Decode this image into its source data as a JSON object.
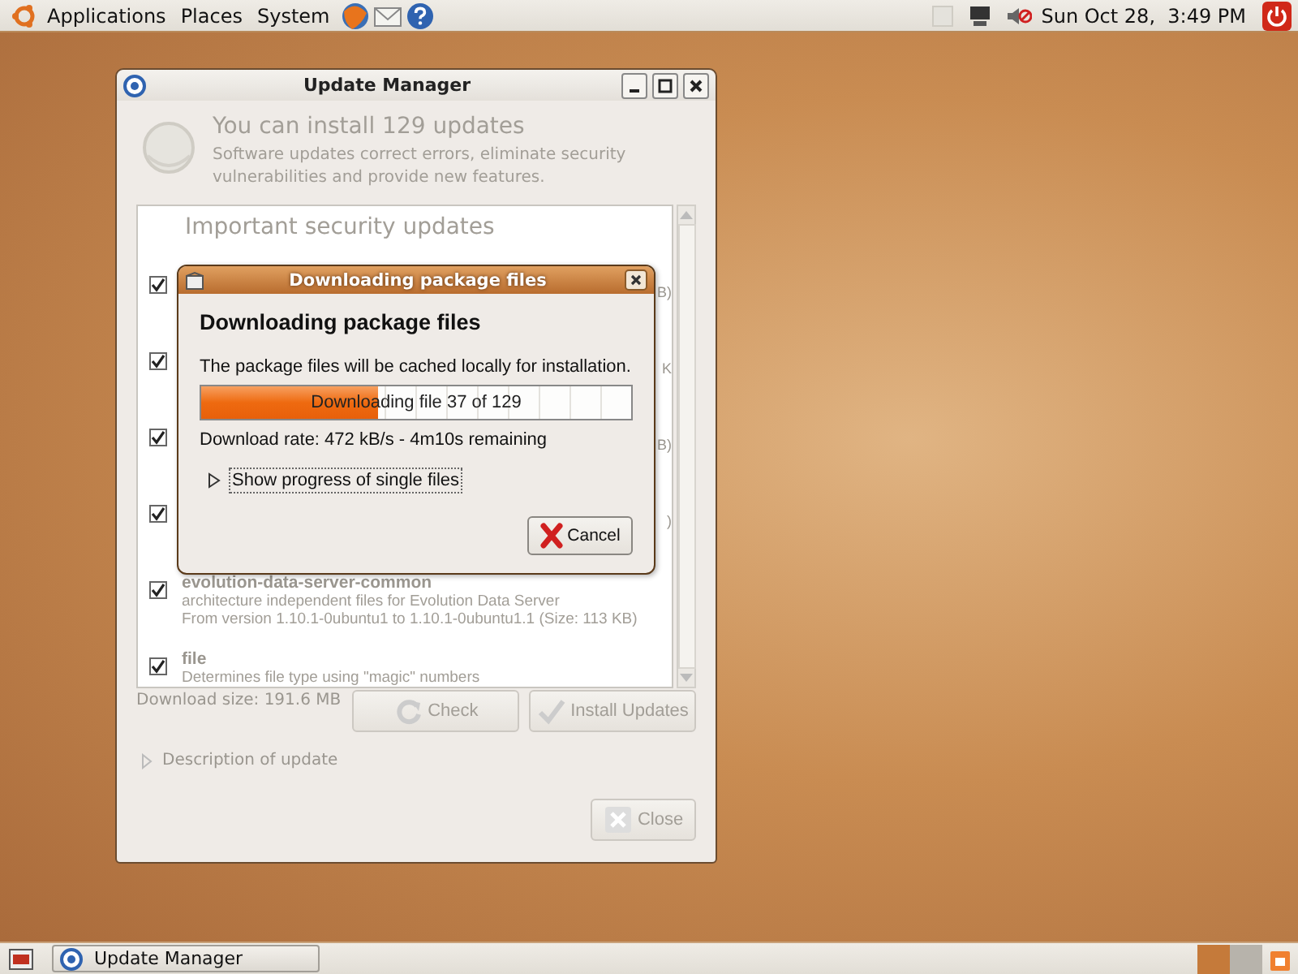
{
  "top_panel": {
    "menus": [
      "Applications",
      "Places",
      "System"
    ],
    "clock": "Sun Oct 28,  3:49 PM"
  },
  "update_window": {
    "title": "Update Manager",
    "insensitive": true,
    "heading": "You can install 129 updates",
    "description": "Software updates correct errors, eliminate security vulnerabilities and provide new features.",
    "list": {
      "section_title": "Important security updates",
      "rows": [
        {
          "checked": true,
          "size_fragment": "B)"
        },
        {
          "checked": true,
          "size_fragment": "K"
        },
        {
          "checked": true,
          "size_fragment": "B)"
        },
        {
          "checked": true,
          "size_fragment": ")"
        },
        {
          "checked": true,
          "name": "evolution-data-server-common",
          "description": "architecture independent files for Evolution Data Server",
          "version": "From version 1.10.1-0ubuntu1 to 1.10.1-0ubuntu1.1 (Size: 113 KB)"
        },
        {
          "checked": true,
          "name": "file",
          "description": "Determines file type using \"magic\" numbers"
        }
      ]
    },
    "download_size": "Download size: 191.6 MB",
    "check_button": "Check",
    "install_button": "Install Updates",
    "expander": "Description of update",
    "close_button": "Close"
  },
  "dialog": {
    "title": "Downloading package files",
    "heading": "Downloading package files",
    "message": "The package files will be cached locally for installation.",
    "progress": {
      "level": 0.41,
      "text": "Downloading file 37 of 129"
    },
    "rate": "Download rate: 472 kB/s - 4m10s remaining",
    "expander": {
      "label": "Show progress of single files",
      "expanded": false
    },
    "cancel_button": "Cancel"
  },
  "taskbar": {
    "items": [
      {
        "label": "Update Manager",
        "selected": false
      }
    ]
  }
}
